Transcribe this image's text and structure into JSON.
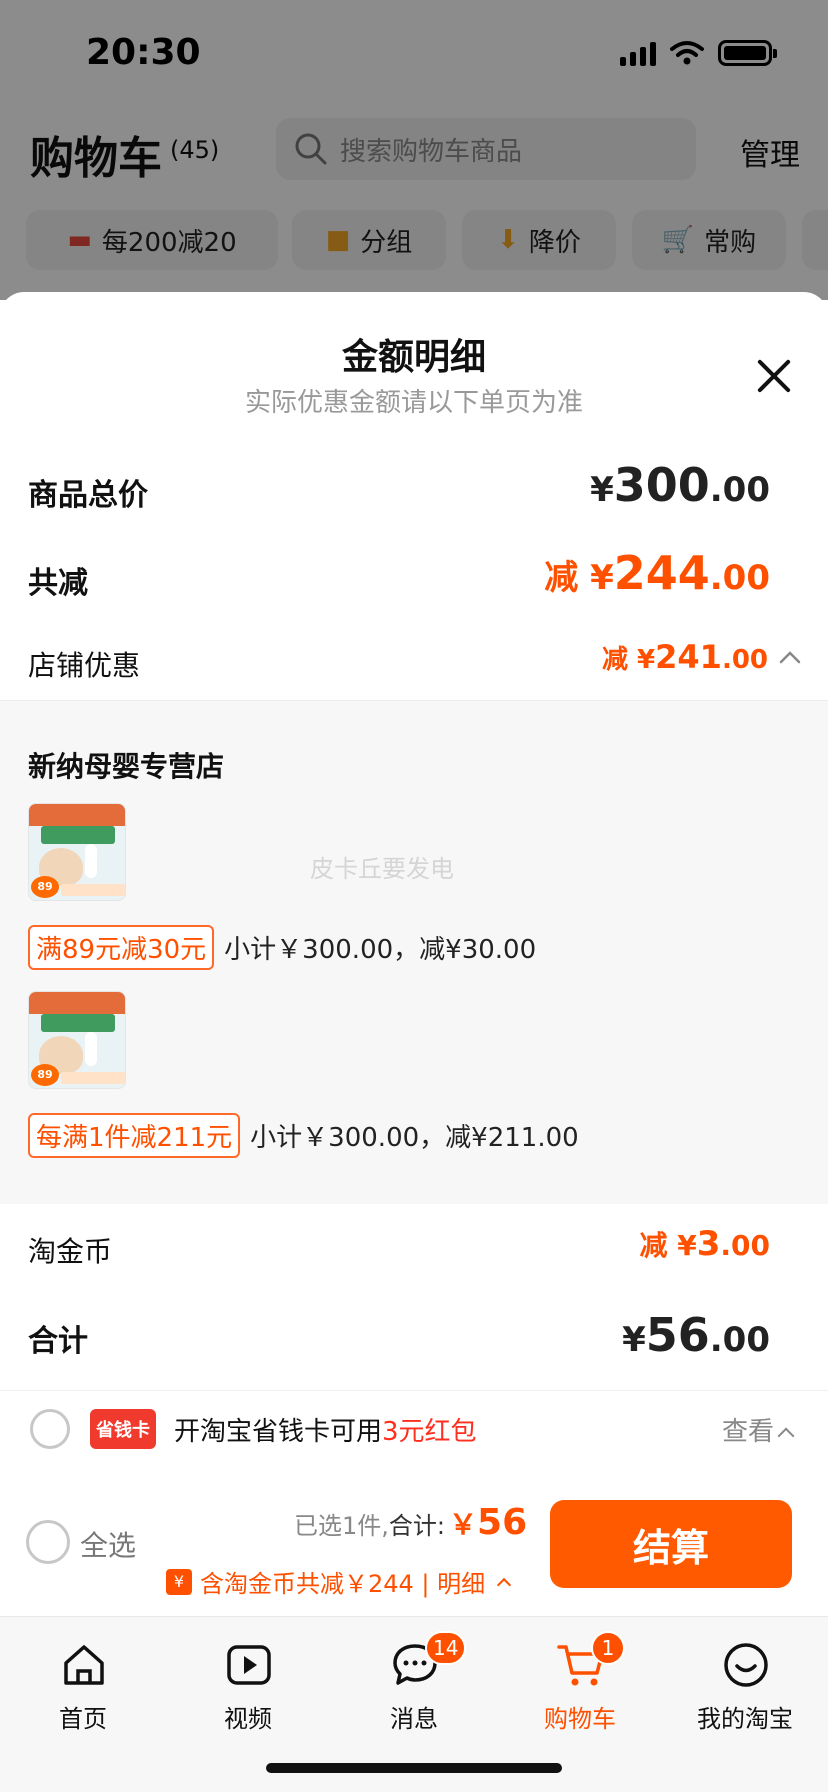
{
  "status_bar": {
    "time": "20:30"
  },
  "cart_header": {
    "title": "购物车",
    "count": "(45)",
    "search_placeholder": "搜索购物车商品",
    "manage": "管理"
  },
  "chips": [
    {
      "label": "每200减20",
      "icon": "store-icon"
    },
    {
      "label": "分组",
      "icon": "folder-icon"
    },
    {
      "label": "降价",
      "icon": "price-drop-icon"
    },
    {
      "label": "常购",
      "icon": "cart-plus-icon"
    }
  ],
  "sheet": {
    "title": "金额明细",
    "subtitle": "实际优惠金额请以下单页为准",
    "rows": {
      "total_price": {
        "label": "商品总价",
        "prefix": "",
        "symbol": "¥",
        "integer": "300",
        "decimal": ".00"
      },
      "discount": {
        "label": "共减",
        "prefix": "减 ",
        "symbol": "¥",
        "integer": "244",
        "decimal": ".00"
      },
      "store_discount": {
        "label": "店铺优惠",
        "prefix": "减 ",
        "symbol": "¥",
        "integer": "241",
        "decimal": ".00"
      },
      "coins": {
        "label": "淘金币",
        "prefix": "减 ",
        "symbol": "¥",
        "integer": "3",
        "decimal": ".00"
      },
      "sum": {
        "label": "合计",
        "prefix": "",
        "symbol": "¥",
        "integer": "56",
        "decimal": ".00"
      }
    },
    "store": {
      "name": "新纳母婴专营店",
      "watermark": "皮卡丘要发电",
      "promotions": [
        {
          "tag": "满89元减30元",
          "subtotal": "小计￥300.00，减¥30.00"
        },
        {
          "tag": "每满1件减211元",
          "subtotal": "小计￥300.00，减¥211.00"
        }
      ]
    }
  },
  "promo_strip": {
    "card_label": "省钱卡",
    "text_prefix": "开淘宝省钱卡可用",
    "text_highlight": "3元红包",
    "view": "查看"
  },
  "checkout": {
    "select_all": "全选",
    "selected_prefix": "已选1件,",
    "total_label": "合计:",
    "yen": "￥",
    "total": "56",
    "coins_badge": "¥",
    "coins_note": "含淘金币共减￥244 | 明细",
    "button": "结算"
  },
  "tab_bar": {
    "tabs": [
      {
        "label": "首页",
        "icon": "home-icon"
      },
      {
        "label": "视频",
        "icon": "video-icon"
      },
      {
        "label": "消息",
        "icon": "message-icon",
        "badge": "14"
      },
      {
        "label": "购物车",
        "icon": "cart-icon",
        "badge": "1",
        "active": true
      },
      {
        "label": "我的淘宝",
        "icon": "profile-icon"
      }
    ]
  },
  "colors": {
    "accent": "#ff5000",
    "button": "#ff5a00",
    "red_text": "#ff2f1f"
  }
}
